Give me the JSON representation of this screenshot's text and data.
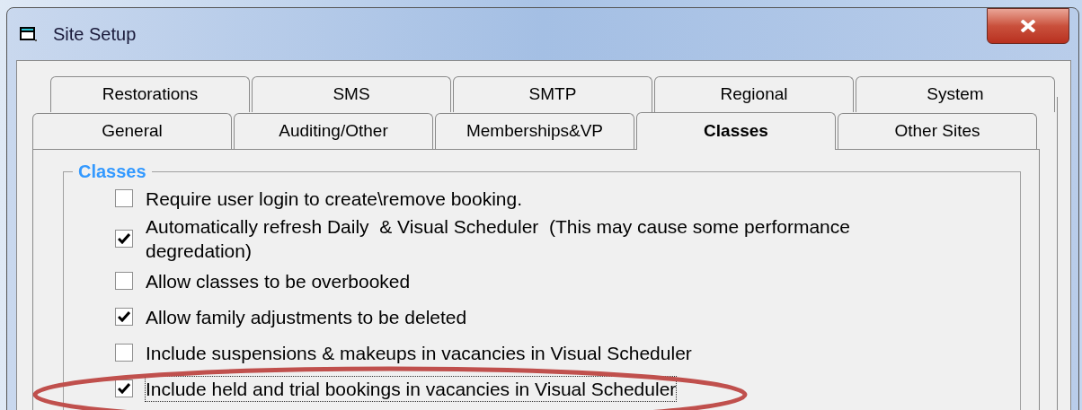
{
  "window": {
    "title": "Site Setup"
  },
  "tab_rows": [
    [
      {
        "label": "Restorations",
        "selected": false
      },
      {
        "label": "SMS",
        "selected": false
      },
      {
        "label": "SMTP",
        "selected": false
      },
      {
        "label": "Regional",
        "selected": false
      },
      {
        "label": "System",
        "selected": false
      }
    ],
    [
      {
        "label": "General",
        "selected": false
      },
      {
        "label": "Auditing/Other",
        "selected": false
      },
      {
        "label": "Memberships&VP",
        "selected": false
      },
      {
        "label": "Classes",
        "selected": true
      },
      {
        "label": "Other Sites",
        "selected": false
      }
    ]
  ],
  "group": {
    "title": "Classes",
    "options": [
      {
        "label": "Require user login to create\\remove booking.",
        "checked": false,
        "focused": false
      },
      {
        "label": "Automatically refresh Daily  & Visual Scheduler  (This may cause some performance degredation)",
        "checked": true,
        "focused": false
      },
      {
        "label": "Allow classes to be overbooked",
        "checked": false,
        "focused": false
      },
      {
        "label": "Allow family adjustments to be deleted",
        "checked": true,
        "focused": false
      },
      {
        "label": "Include suspensions & makeups in vacancies in Visual Scheduler",
        "checked": false,
        "focused": false
      },
      {
        "label": "Include held and trial bookings in vacancies in Visual Scheduler",
        "checked": true,
        "focused": true
      }
    ]
  }
}
